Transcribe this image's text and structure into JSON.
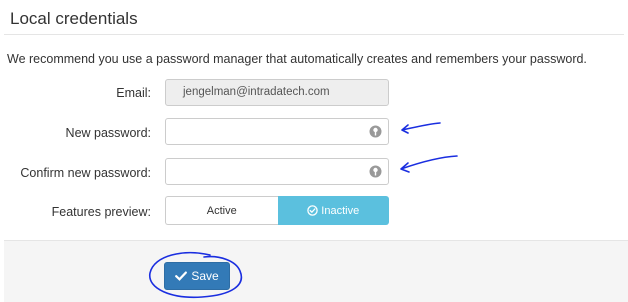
{
  "section": {
    "title": "Local credentials",
    "intro": "We recommend you use a password manager that automatically creates and remembers your password."
  },
  "form": {
    "email": {
      "label": "Email:",
      "value": "jengelman@intradatech.com"
    },
    "new_password": {
      "label": "New password:",
      "value": "",
      "icon": "key-icon"
    },
    "confirm_password": {
      "label": "Confirm new password:",
      "value": "",
      "icon": "key-icon"
    },
    "features_preview": {
      "label": "Features preview:",
      "options": [
        "Active",
        "Inactive"
      ],
      "selected": "Inactive",
      "selected_icon": "check-circle-icon"
    }
  },
  "footer": {
    "save_label": "Save",
    "save_icon": "check-icon"
  },
  "annotations": {
    "ink_color": "#1a2ee0"
  },
  "colors": {
    "primary": "#337ab7",
    "info": "#5bc0de"
  }
}
